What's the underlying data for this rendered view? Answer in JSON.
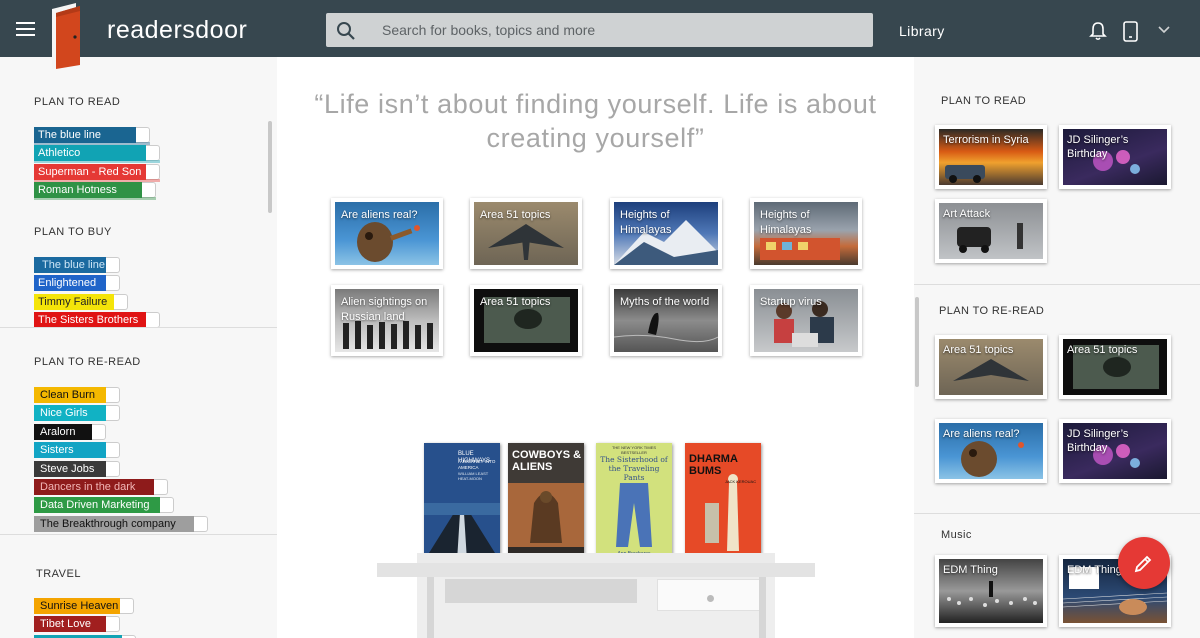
{
  "app": {
    "brand": "readersdoor"
  },
  "topbar": {
    "search_placeholder": "Search for books, topics and more",
    "library_label": "Library",
    "icons": [
      "menu-icon",
      "door-logo",
      "search-icon",
      "bell-icon",
      "phone-icon",
      "chevron-down-icon"
    ]
  },
  "left": {
    "sections": [
      {
        "title": "PLAN TO READ",
        "books": [
          {
            "label": "The blue line",
            "color": "#1a6591",
            "w": 104
          },
          {
            "label": "Athletico",
            "color": "#11a3b4",
            "w": 114
          },
          {
            "label": "Superman - Red Son",
            "color": "#e53935",
            "w": 114
          },
          {
            "label": "Roman Hotness",
            "color": "#2f9245",
            "w": 110
          }
        ]
      },
      {
        "title": "PLAN TO BUY",
        "books": [
          {
            "label": "The blue line",
            "color": "#1b6aa0",
            "w": 74
          },
          {
            "label": "Enlightened",
            "color": "#1f64c9",
            "w": 74
          },
          {
            "label": "Timmy Failure",
            "color": "#f4e409",
            "w": 82,
            "text": "#222"
          },
          {
            "label": "The Sisters Brothers",
            "color": "#e01414",
            "w": 114
          }
        ]
      },
      {
        "title": "PLAN TO RE-READ",
        "books": [
          {
            "label": "Clean Burn",
            "color": "#f4b800",
            "w": 74,
            "text": "#111"
          },
          {
            "label": "Nice Girls",
            "color": "#11b2c4",
            "w": 74
          },
          {
            "label": "Aralorn",
            "color": "#111111",
            "w": 60
          },
          {
            "label": "Sisters",
            "color": "#12a4c4",
            "w": 74
          },
          {
            "label": "Steve Jobs",
            "color": "#3a3a3a",
            "w": 74
          },
          {
            "label": "Dancers in the dark",
            "color": "#8e1b1b",
            "w": 122
          },
          {
            "label": "Data Driven Marketing",
            "color": "#2e9a45",
            "w": 128
          },
          {
            "label": "The Breakthrough company",
            "color": "#9e9e9e",
            "w": 162,
            "text": "#111"
          }
        ]
      },
      {
        "title": "TRAVEL",
        "books": [
          {
            "label": "Sunrise Heaven",
            "color": "#f4a400",
            "w": 88,
            "text": "#111"
          },
          {
            "label": "Tibet Love",
            "color": "#a11f1f",
            "w": 74
          },
          {
            "label": "",
            "color": "#11a3b4",
            "w": 90
          }
        ]
      }
    ]
  },
  "center": {
    "quote": "“Life isn’t about finding yourself. Life is about creating yourself”",
    "topics": [
      {
        "label": "Are aliens real?",
        "img": "alien"
      },
      {
        "label": "Area 51 topics",
        "img": "plane"
      },
      {
        "label": "Heights of Himalayas",
        "img": "mountain"
      },
      {
        "label": "Heights of Himalayas",
        "img": "bus"
      },
      {
        "label": "Alien sightings on Russian land",
        "img": "crowd"
      },
      {
        "label": "Area 51 topics",
        "img": "dark"
      },
      {
        "label": "Myths of the world",
        "img": "lake"
      },
      {
        "label": "Startup virus",
        "img": "office"
      }
    ],
    "shelf_books": [
      {
        "title": "BLUE HIGHWAYS",
        "sub": "A JOURNEY INTO AMERICA",
        "author": "WILLIAM LEAST HEAT-MOON",
        "style": "blue"
      },
      {
        "title": "COWBOYS & ALIENS",
        "sub": "",
        "author": "",
        "style": "cowboys"
      },
      {
        "title": "The Sisterhood of the Traveling Pants",
        "sub": "THE NEW YORK TIMES BESTSELLER",
        "author": "Ann Brashares",
        "style": "pants"
      },
      {
        "title": "DHARMA BUMS",
        "sub": "",
        "author": "JACK KEROUAC",
        "style": "dharma"
      }
    ]
  },
  "right": {
    "sections": [
      {
        "title": "PLAN TO READ",
        "tiles": [
          {
            "label": "Terrorism in Syria",
            "img": "fire"
          },
          {
            "label": "JD Silinger’s Birthday",
            "img": "party"
          },
          {
            "label": "Art Attack",
            "img": "car"
          }
        ]
      },
      {
        "title": "PLAN TO RE-READ",
        "tiles": [
          {
            "label": "Area 51 topics",
            "img": "plane"
          },
          {
            "label": "Area 51 topics",
            "img": "dark"
          },
          {
            "label": "Are aliens real?",
            "img": "alien"
          },
          {
            "label": "JD Silinger’s Birthday",
            "img": "party"
          }
        ]
      },
      {
        "title": "Music",
        "tiles": [
          {
            "label": "EDM Thing",
            "img": "stadium"
          },
          {
            "label": "EDM Thing",
            "img": "guitar"
          }
        ]
      }
    ]
  },
  "colors": {
    "topbar": "#37474f",
    "accent": "#e53935"
  }
}
